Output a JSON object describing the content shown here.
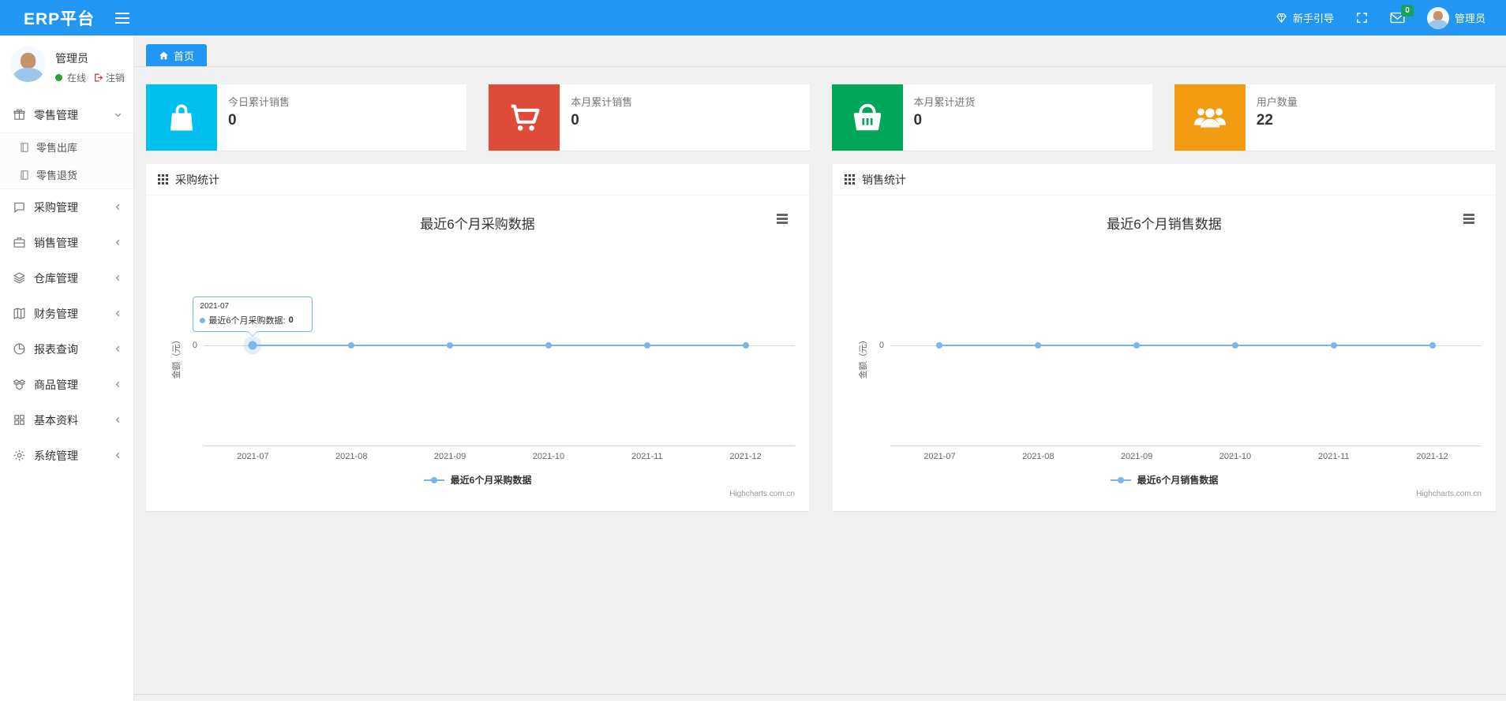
{
  "theme": {
    "accent": "#2196f3",
    "series_blue": "#7cb5ec",
    "online_green": "#2e9e2e",
    "badge_green": "#17a35b",
    "logout_red": "#d43f3a",
    "card_colors": [
      "#00c0ef",
      "#dd4b39",
      "#00a65a",
      "#f39c12"
    ]
  },
  "topbar": {
    "brand": "ERP平台",
    "guide_label": "新手引导",
    "mail_badge": "0",
    "username": "管理员"
  },
  "sidebar": {
    "user": {
      "name": "管理员",
      "status": "在线",
      "logout": "注销"
    },
    "menu": [
      {
        "label": "零售管理",
        "icon": "gift-icon",
        "state": "expanded"
      },
      {
        "label": "采购管理",
        "icon": "chat-icon",
        "state": "collapsed"
      },
      {
        "label": "销售管理",
        "icon": "briefcase-icon",
        "state": "collapsed"
      },
      {
        "label": "仓库管理",
        "icon": "layers-icon",
        "state": "collapsed"
      },
      {
        "label": "财务管理",
        "icon": "book-icon",
        "state": "collapsed"
      },
      {
        "label": "报表查询",
        "icon": "pie-chart-icon",
        "state": "collapsed"
      },
      {
        "label": "商品管理",
        "icon": "box-icon",
        "state": "collapsed"
      },
      {
        "label": "基本资料",
        "icon": "grid-icon",
        "state": "collapsed"
      },
      {
        "label": "系统管理",
        "icon": "gear-icon",
        "state": "collapsed"
      }
    ],
    "submenu": [
      {
        "label": "零售出库",
        "icon": "journal-icon"
      },
      {
        "label": "零售退货",
        "icon": "journal-icon"
      }
    ]
  },
  "tabs": {
    "home": "首页"
  },
  "stat_cards": [
    {
      "label": "今日累计销售",
      "value": "0",
      "color": "#00c0ef",
      "icon": "bag-icon"
    },
    {
      "label": "本月累计销售",
      "value": "0",
      "color": "#dd4b39",
      "icon": "cart-icon"
    },
    {
      "label": "本月累计进货",
      "value": "0",
      "color": "#00a65a",
      "icon": "basket-icon"
    },
    {
      "label": "用户数量",
      "value": "22",
      "color": "#f39c12",
      "icon": "users-icon"
    }
  ],
  "panels": [
    {
      "title": "采购统计"
    },
    {
      "title": "销售统计"
    }
  ],
  "chart_data": [
    {
      "type": "line",
      "title": "最近6个月采购数据",
      "categories": [
        "2021-07",
        "2021-08",
        "2021-09",
        "2021-10",
        "2021-11",
        "2021-12"
      ],
      "series": [
        {
          "name": "最近6个月采购数据",
          "values": [
            0,
            0,
            0,
            0,
            0,
            0
          ]
        }
      ],
      "xlabel": "",
      "ylabel": "金额（元）",
      "yticks": [
        "0"
      ],
      "ylim": [
        -1,
        1
      ],
      "grid": true,
      "legend_position": "bottom",
      "series_color": "#7cb5ec",
      "credit": "Highcharts.com.cn",
      "tooltip": {
        "category": "2021-07",
        "label": "最近6个月采购数据:",
        "value": "0"
      }
    },
    {
      "type": "line",
      "title": "最近6个月销售数据",
      "categories": [
        "2021-07",
        "2021-08",
        "2021-09",
        "2021-10",
        "2021-11",
        "2021-12"
      ],
      "series": [
        {
          "name": "最近6个月销售数据",
          "values": [
            0,
            0,
            0,
            0,
            0,
            0
          ]
        }
      ],
      "xlabel": "",
      "ylabel": "金额（元）",
      "yticks": [
        "0"
      ],
      "ylim": [
        -1,
        1
      ],
      "grid": true,
      "legend_position": "bottom",
      "series_color": "#7cb5ec",
      "credit": "Highcharts.com.cn",
      "tooltip": null
    }
  ]
}
